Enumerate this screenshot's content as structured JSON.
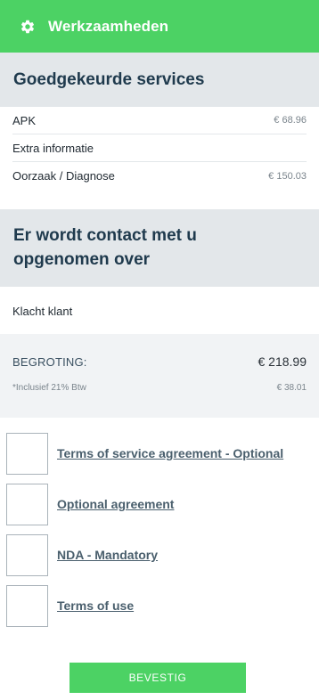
{
  "header": {
    "title": "Werkzaamheden",
    "icon": "gear-icon",
    "color": "#4cd264"
  },
  "approved": {
    "heading": "Goedgekeurde services",
    "items": [
      {
        "label": "APK",
        "amount": "€ 68.96"
      },
      {
        "label": "Extra informatie",
        "amount": ""
      },
      {
        "label": "Oorzaak / Diagnose",
        "amount": "€ 150.03"
      }
    ]
  },
  "contact": {
    "heading_line1": "Er wordt contact met u",
    "heading_line2": "opgenomen over",
    "items": [
      {
        "label": "Klacht klant"
      }
    ]
  },
  "budget": {
    "label": "BEGROTING:",
    "total": "€ 218.99",
    "vat_label": "*Inclusief 21% Btw",
    "vat_amount": "€ 38.01"
  },
  "agreements": [
    {
      "label": "Terms of service agreement - Optional",
      "checked": false
    },
    {
      "label": "Optional agreement",
      "checked": false
    },
    {
      "label": "NDA - Mandatory",
      "checked": false
    },
    {
      "label": "Terms of use",
      "checked": false
    }
  ],
  "confirm_button": {
    "label": "BEVESTIG"
  }
}
